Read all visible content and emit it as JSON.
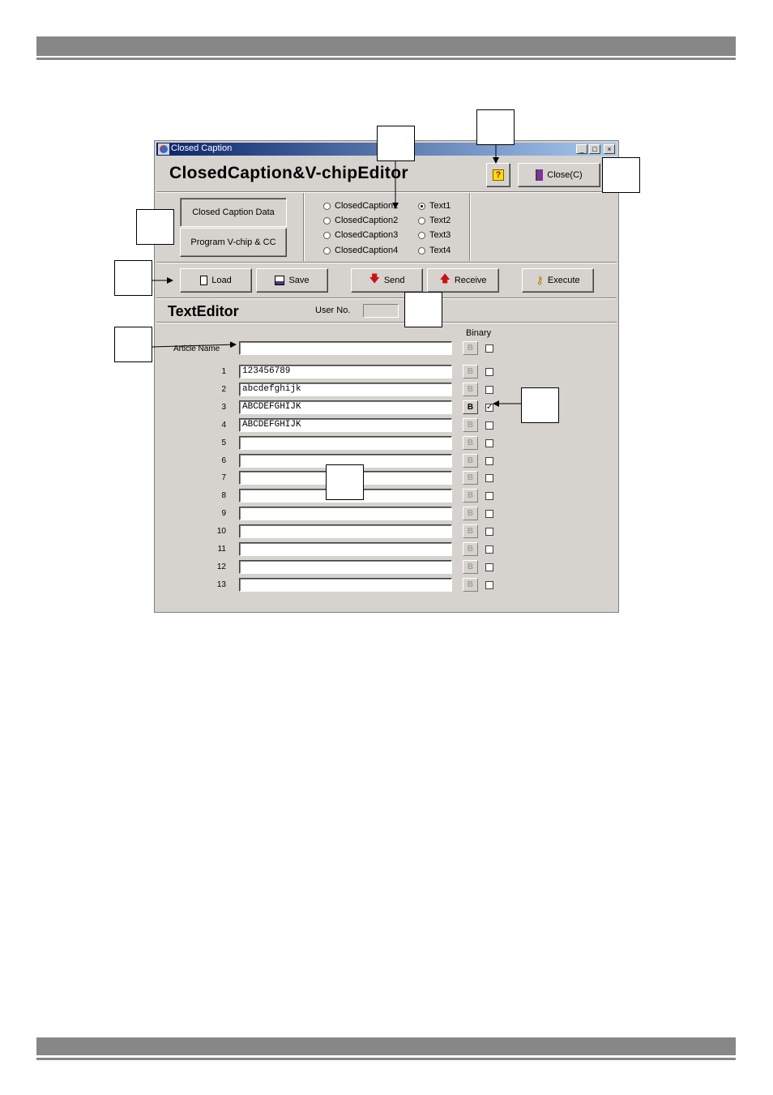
{
  "window": {
    "title": "Closed Caption",
    "app_title": "ClosedCaption&V-chipEditor",
    "help_label": "?",
    "close_label": "Close(C)"
  },
  "mode_buttons": [
    "Closed Caption Data",
    "Program V-chip & CC"
  ],
  "caption_channels": [
    {
      "label": "ClosedCaption1",
      "selected": false
    },
    {
      "label": "ClosedCaption2",
      "selected": false
    },
    {
      "label": "ClosedCaption3",
      "selected": false
    },
    {
      "label": "ClosedCaption4",
      "selected": false
    }
  ],
  "text_channels": [
    {
      "label": "Text1",
      "selected": true
    },
    {
      "label": "Text2",
      "selected": false
    },
    {
      "label": "Text3",
      "selected": false
    },
    {
      "label": "Text4",
      "selected": false
    }
  ],
  "toolbar": {
    "load": "Load",
    "save": "Save",
    "send": "Send",
    "receive": "Receive",
    "execute": "Execute"
  },
  "editor": {
    "title": "TextEditor",
    "user_no_label": "User No.",
    "user_no_value": "",
    "binary_header": "Binary",
    "article_label": "Article Name",
    "article_value": "",
    "article_binary": false,
    "b_label": "B"
  },
  "rows": [
    {
      "num": "1",
      "text": "123456789",
      "binary": false
    },
    {
      "num": "2",
      "text": "abcdefghijk",
      "binary": false
    },
    {
      "num": "3",
      "text": "ABCDEFGHIJK",
      "binary": true
    },
    {
      "num": "4",
      "text": "ABCDEFGHIJK",
      "binary": false
    },
    {
      "num": "5",
      "text": "",
      "binary": false
    },
    {
      "num": "6",
      "text": "",
      "binary": false
    },
    {
      "num": "7",
      "text": "",
      "binary": false
    },
    {
      "num": "8",
      "text": "",
      "binary": false
    },
    {
      "num": "9",
      "text": "",
      "binary": false
    },
    {
      "num": "10",
      "text": "",
      "binary": false
    },
    {
      "num": "11",
      "text": "",
      "binary": false
    },
    {
      "num": "12",
      "text": "",
      "binary": false
    },
    {
      "num": "13",
      "text": "",
      "binary": false
    }
  ]
}
